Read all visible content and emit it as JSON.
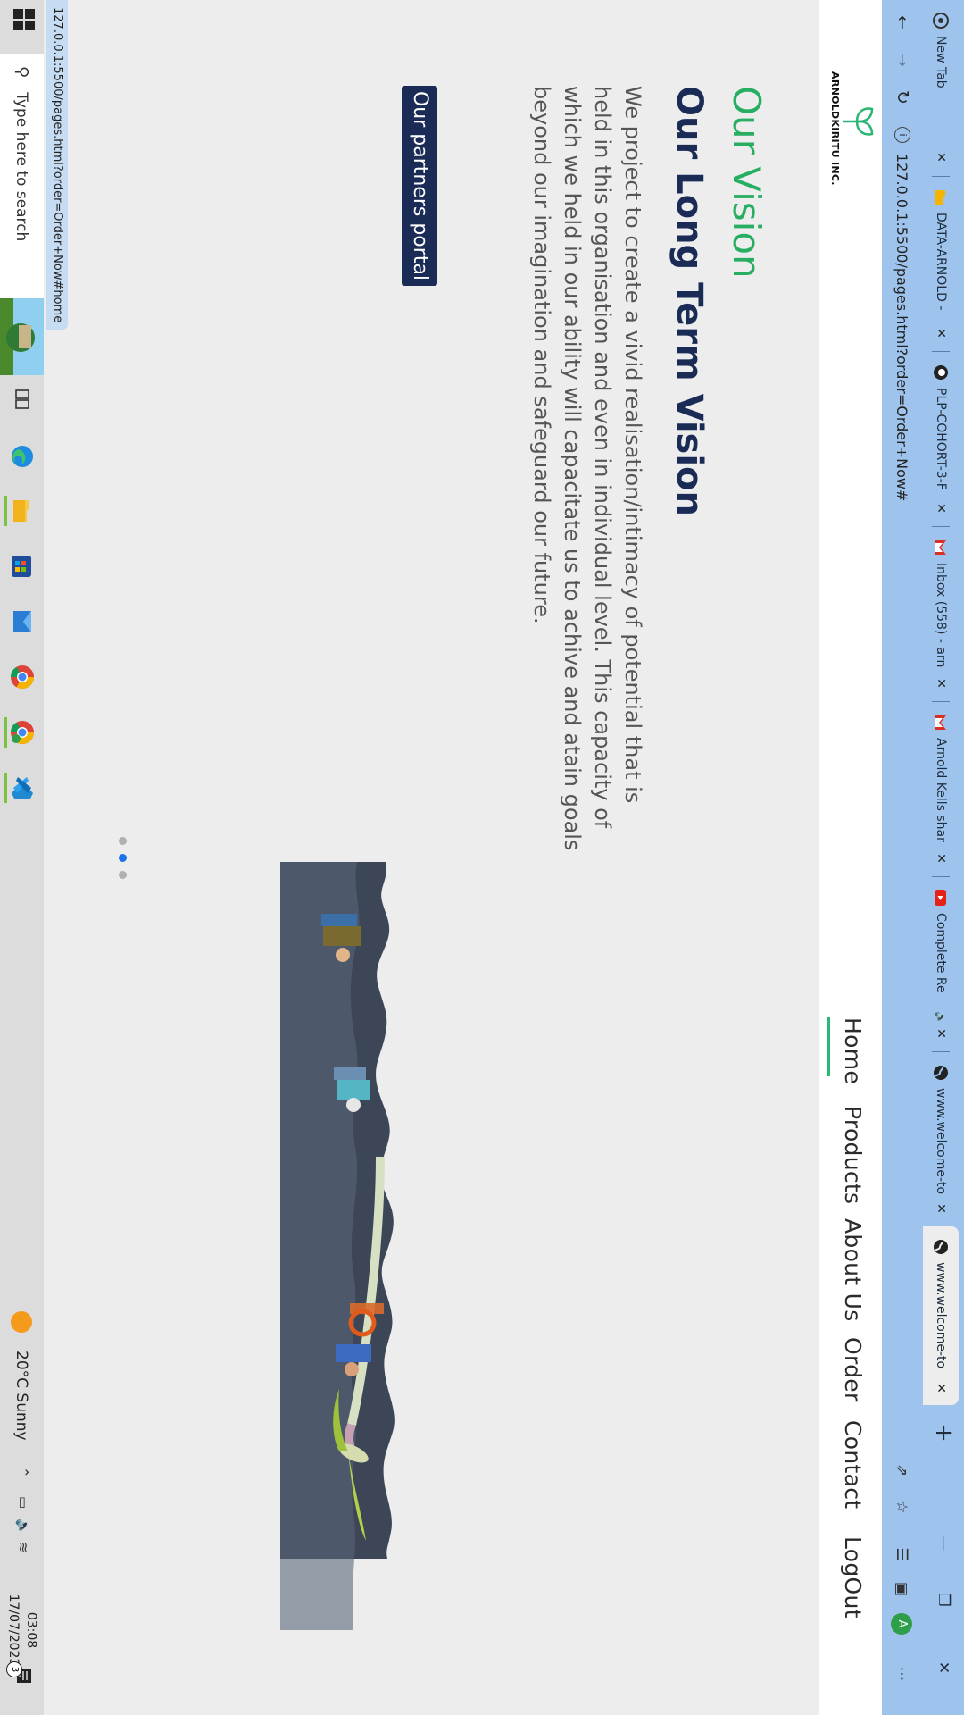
{
  "browser": {
    "tabs": [
      {
        "title": "New Tab",
        "icon": "chrome-icon",
        "active": false
      },
      {
        "title": "DATA-ARNOLD -",
        "icon": "folder-icon",
        "active": false
      },
      {
        "title": "PLP-COHORT-3-F",
        "icon": "github-icon",
        "active": false
      },
      {
        "title": "Inbox (558) - arn",
        "icon": "gmail-icon",
        "active": false
      },
      {
        "title": "Arnold Kells shar",
        "icon": "gmail-icon",
        "active": false
      },
      {
        "title": "Complete Re",
        "icon": "youtube-icon",
        "active": false
      },
      {
        "title": "www.welcome-to",
        "icon": "globe-icon",
        "active": false
      },
      {
        "title": "www.welcome-to",
        "icon": "globe-icon",
        "active": true
      }
    ],
    "address": "127.0.0.1:5500/pages.html?order=Order+Now#",
    "profile_initial": "A",
    "status_url": "127.0.0.1:5500/pages.html?order=Order+Now#home"
  },
  "site": {
    "brand": "ARNOLDKIRITU INC.",
    "nav": [
      "Home",
      "Products",
      "About Us",
      "Order",
      "Contact",
      "LogOut"
    ],
    "active_nav": "Home",
    "accent": "#2bb673",
    "navy": "#1a2b55"
  },
  "vision": {
    "label": "Our Vision",
    "heading": "Our Long Term Vision",
    "body": "We project to create a vivid realisation/intimacy of potential that is held in this organisation and even in individual level. This capacity of which we held in our ability will capacitate us to achive and atain goals beyond our imagination and safeguard our future.",
    "button": "Our partners portal"
  },
  "carousel": {
    "count": 3,
    "active_index": 1
  },
  "taskbar": {
    "search_placeholder": "Type here to search",
    "weather": "20°C  Sunny",
    "time": "03:08",
    "date": "17/07/2023",
    "notifications": "3"
  }
}
